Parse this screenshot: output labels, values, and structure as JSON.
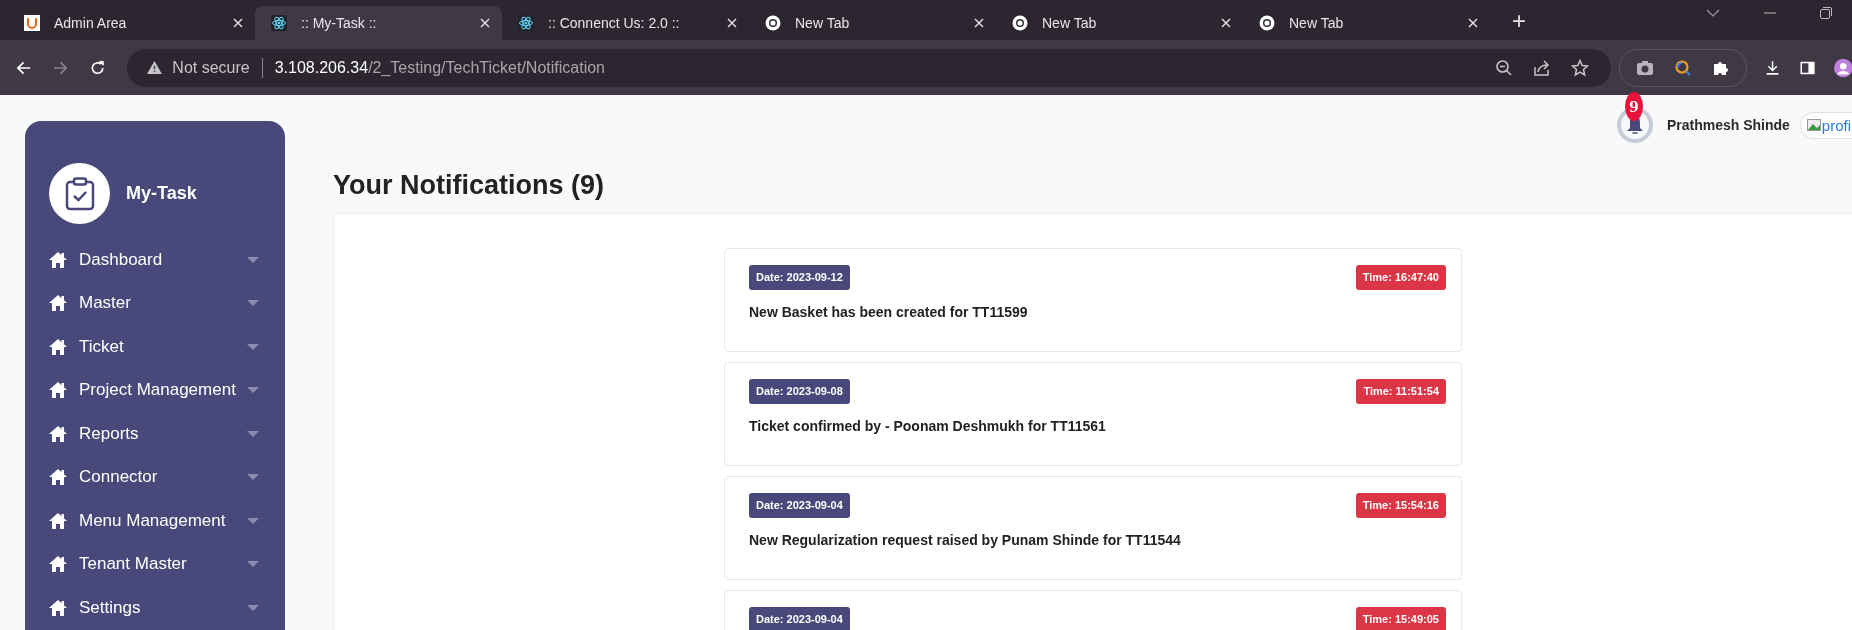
{
  "browser": {
    "tabs": [
      {
        "title": "Admin Area",
        "kind": "admin",
        "selected": false
      },
      {
        "title": ":: My-Task ::",
        "kind": "react",
        "selected": true
      },
      {
        "title": ":: Connenct Us: 2.0 ::",
        "kind": "react",
        "selected": false
      },
      {
        "title": "New Tab",
        "kind": "chrome",
        "selected": false
      },
      {
        "title": "New Tab",
        "kind": "chrome",
        "selected": false
      },
      {
        "title": "New Tab",
        "kind": "chrome",
        "selected": false
      }
    ],
    "new_tab": "+",
    "address": {
      "security": "Not secure",
      "host": "3.108.206.34",
      "path": "/2_Testing/TechTicket/Notification"
    }
  },
  "sidebar": {
    "app_name": "My-Task",
    "items": [
      {
        "label": "Dashboard"
      },
      {
        "label": "Master"
      },
      {
        "label": "Ticket"
      },
      {
        "label": "Project Management"
      },
      {
        "label": "Reports"
      },
      {
        "label": "Connector"
      },
      {
        "label": "Menu Management"
      },
      {
        "label": "Tenant Master"
      },
      {
        "label": "Settings"
      }
    ]
  },
  "header": {
    "notification_count": "9",
    "user_name": "Prathmesh Shinde",
    "profile_image_alt": "profi"
  },
  "page_title": "Your Notifications (9)",
  "notifications": [
    {
      "date": "Date: 2023-09-12",
      "time": "Time: 16:47:40",
      "message": "New Basket has been created for TT11599"
    },
    {
      "date": "Date: 2023-09-08",
      "time": "Time: 11:51:54",
      "message": "Ticket confirmed by - Poonam Deshmukh for TT11561"
    },
    {
      "date": "Date: 2023-09-04",
      "time": "Time: 15:54:16",
      "message": "New Regularization request raised by Punam Shinde for TT11544"
    },
    {
      "date": "Date: 2023-09-04",
      "time": "Time: 15:49:05"
    }
  ]
}
